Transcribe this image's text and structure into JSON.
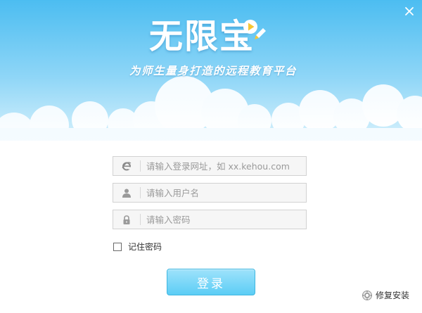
{
  "window": {
    "close_icon": "close-icon"
  },
  "brand": {
    "logo_text": "无限宝",
    "slogan": "为师生量身打造的远程教育平台",
    "colors": {
      "sky_top": "#4fc0f2",
      "sky_bottom": "#e3f5fd",
      "accent": "#5ccdf5"
    }
  },
  "form": {
    "url_field": {
      "icon": "browser-e-icon",
      "placeholder": "请输入登录网址，如 xx.kehou.com",
      "value": ""
    },
    "username_field": {
      "icon": "user-icon",
      "placeholder": "请输入用户名",
      "value": ""
    },
    "password_field": {
      "icon": "lock-icon",
      "placeholder": "请输入密码",
      "value": ""
    },
    "remember": {
      "label": "记住密码",
      "checked": false
    },
    "login_label": "登录"
  },
  "footer": {
    "repair_label": "修复安装",
    "repair_icon": "wrench-gear-icon"
  }
}
